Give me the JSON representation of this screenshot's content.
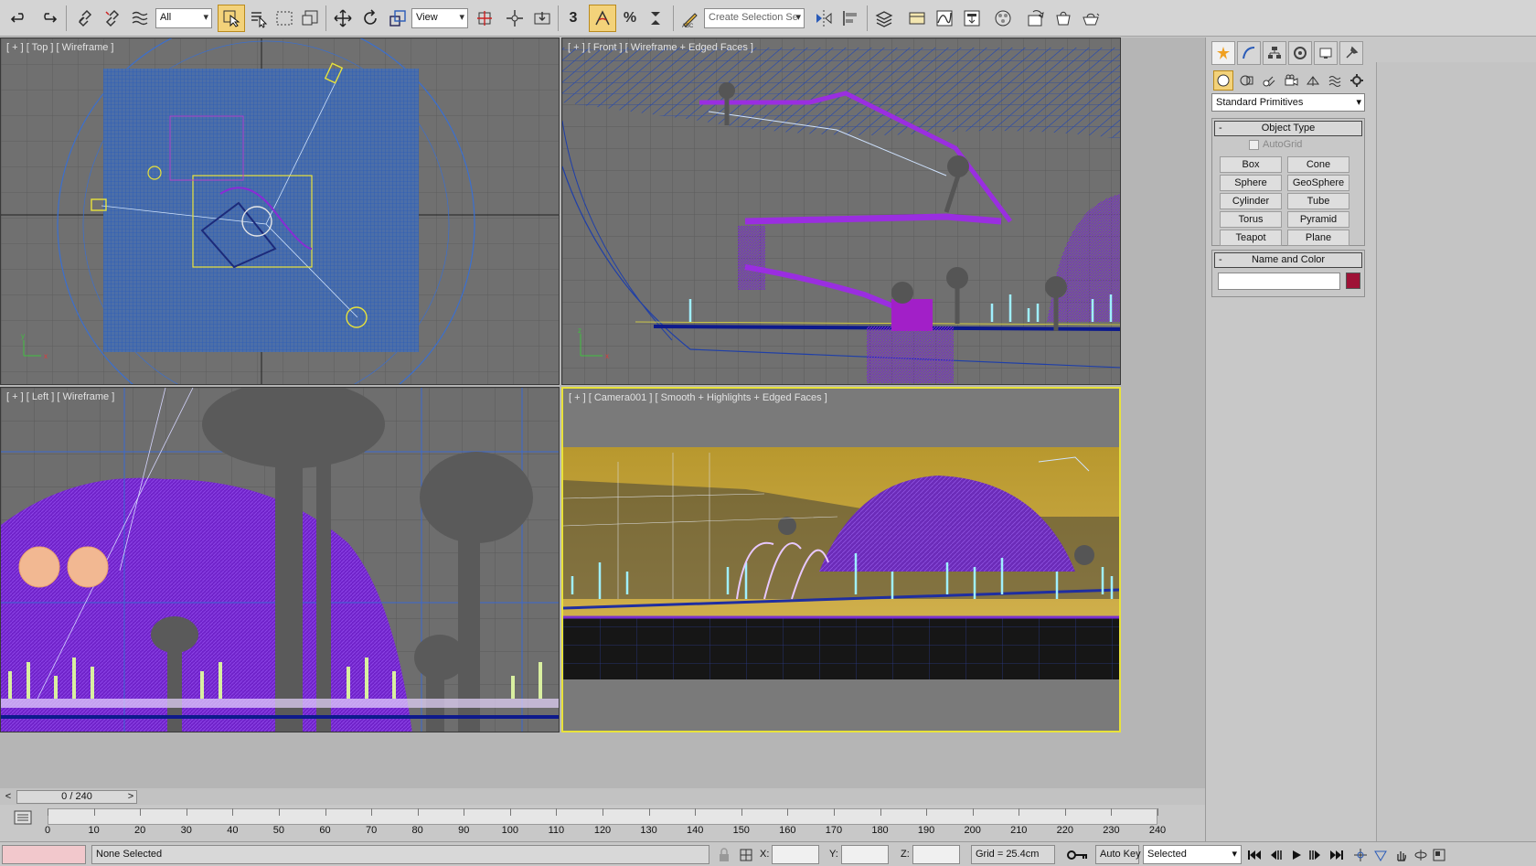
{
  "toolbar": {
    "selection_filter": "All",
    "reference_coord": "View",
    "snap_value": "3",
    "named_selection_placeholder": "Create Selection Se"
  },
  "viewports": {
    "top": "[ + ] [ Top ] [ Wireframe ]",
    "front": "[ + ] [ Front ] [ Wireframe + Edged Faces ]",
    "left": "[ + ] [ Left ] [ Wireframe ]",
    "camera": "[ + ] [ Camera001 ] [ Smooth + Highlights + Edged Faces ]"
  },
  "command_panel": {
    "category_dropdown": "Standard Primitives",
    "object_type_title": "Object Type",
    "autogrid_label": "AutoGrid",
    "buttons": [
      "Box",
      "Cone",
      "Sphere",
      "GeoSphere",
      "Cylinder",
      "Tube",
      "Torus",
      "Pyramid",
      "Teapot",
      "Plane"
    ],
    "name_color_title": "Name and Color",
    "swatch_color": "#9e1236"
  },
  "timeline": {
    "frame_display": "0 / 240",
    "ticks": [
      "0",
      "10",
      "20",
      "30",
      "40",
      "50",
      "60",
      "70",
      "80",
      "90",
      "100",
      "110",
      "120",
      "130",
      "140",
      "150",
      "160",
      "170",
      "180",
      "190",
      "200",
      "210",
      "220",
      "230",
      "240"
    ]
  },
  "status": {
    "selection_text": "None Selected",
    "x_label": "X:",
    "y_label": "Y:",
    "z_label": "Z:",
    "grid_text": "Grid = 25.4cm",
    "auto_key": "Auto Key",
    "key_filter": "Selected"
  },
  "colors": {
    "wire_blue": "#2a5bb8",
    "wire_purple": "#7a24d6",
    "active_viewport": "#e8e23a",
    "sky": "#c6a43a"
  }
}
